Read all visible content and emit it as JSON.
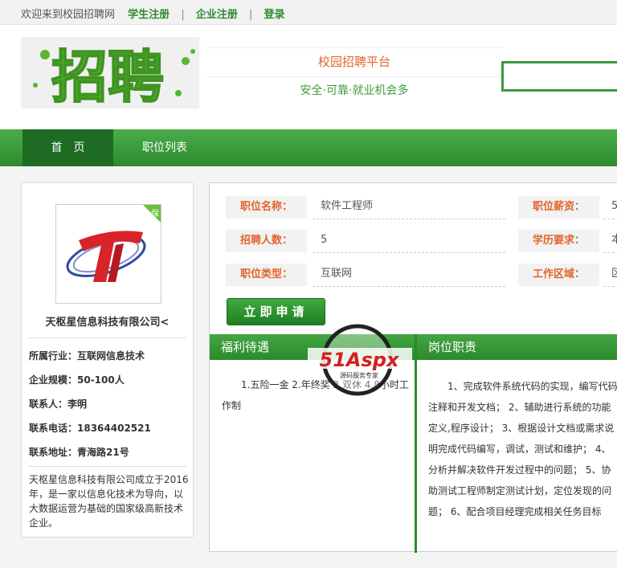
{
  "topbar": {
    "welcome": "欢迎来到校园招聘网",
    "student_register": "学生注册",
    "sep1": "|",
    "company_register": "企业注册",
    "sep2": "|",
    "login": "登录"
  },
  "header": {
    "logo_text": "招聘",
    "slogan_title": "校园招聘平台",
    "slogan_sub": "安全·可靠·就业机会多",
    "search_placeholder": ""
  },
  "nav": {
    "items": [
      {
        "label": "首　页",
        "active": true
      },
      {
        "label": "职位列表",
        "active": false
      }
    ]
  },
  "company": {
    "badge": "保",
    "name": "天枢星信息科技有限公司<",
    "industry": "所属行业：互联网信息技术",
    "scale": "企业规模：50-100人",
    "contact": "联系人：李明",
    "phone": "联系电话：18364402521",
    "address": "联系地址：青海路21号",
    "description": "天枢星信息科技有限公司成立于2016年，是一家以信息化技术为导向，以大数据运营为基础的国家级高新技术企业。"
  },
  "job": {
    "name_label": "职位名称：",
    "name_value": "软件工程师",
    "salary_label": "职位薪资：",
    "salary_value": "5",
    "count_label": "招聘人数：",
    "count_value": "5",
    "edu_label": "学历要求：",
    "edu_value": "本",
    "type_label": "职位类型：",
    "type_value": "互联网",
    "area_label": "工作区域：",
    "area_value": "区",
    "apply_label": "立即申请",
    "welfare_title": "福利待遇",
    "welfare_body": "1.五险一金 2.年终奖 3.双休 4.8小时工作制",
    "duty_title": "岗位职责",
    "duty_body": "1、完成软件系统代码的实现，编写代码注释和开发文档； 2、辅助进行系统的功能定义,程序设计； 3、根据设计文档或需求说明完成代码编写，调试，测试和维护； 4、分析并解决软件开发过程中的问题； 5、协助测试工程师制定测试计划，定位发现的问题； 6、配合项目经理完成相关任务目标"
  },
  "watermark": {
    "brand": "51Aspx",
    "tagline": "源码服务专家"
  },
  "colors": {
    "brand_green": "#2d8a2d",
    "label_orange": "#e0642b"
  }
}
